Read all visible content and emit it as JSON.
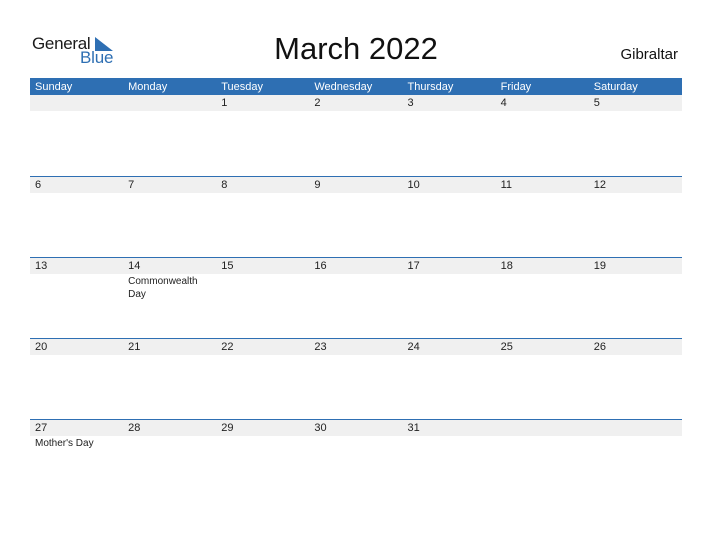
{
  "logo": {
    "word1": "General",
    "word2": "Blue"
  },
  "title": "March 2022",
  "country": "Gibraltar",
  "colors": {
    "accent": "#2e6fb3",
    "band": "#f0f0f0"
  },
  "weekdays": [
    "Sunday",
    "Monday",
    "Tuesday",
    "Wednesday",
    "Thursday",
    "Friday",
    "Saturday"
  ],
  "weeks": [
    {
      "days": [
        {
          "num": "",
          "event": ""
        },
        {
          "num": "",
          "event": ""
        },
        {
          "num": "1",
          "event": ""
        },
        {
          "num": "2",
          "event": ""
        },
        {
          "num": "3",
          "event": ""
        },
        {
          "num": "4",
          "event": ""
        },
        {
          "num": "5",
          "event": ""
        }
      ]
    },
    {
      "days": [
        {
          "num": "6",
          "event": ""
        },
        {
          "num": "7",
          "event": ""
        },
        {
          "num": "8",
          "event": ""
        },
        {
          "num": "9",
          "event": ""
        },
        {
          "num": "10",
          "event": ""
        },
        {
          "num": "11",
          "event": ""
        },
        {
          "num": "12",
          "event": ""
        }
      ]
    },
    {
      "days": [
        {
          "num": "13",
          "event": ""
        },
        {
          "num": "14",
          "event": "Commonwealth Day"
        },
        {
          "num": "15",
          "event": ""
        },
        {
          "num": "16",
          "event": ""
        },
        {
          "num": "17",
          "event": ""
        },
        {
          "num": "18",
          "event": ""
        },
        {
          "num": "19",
          "event": ""
        }
      ]
    },
    {
      "days": [
        {
          "num": "20",
          "event": ""
        },
        {
          "num": "21",
          "event": ""
        },
        {
          "num": "22",
          "event": ""
        },
        {
          "num": "23",
          "event": ""
        },
        {
          "num": "24",
          "event": ""
        },
        {
          "num": "25",
          "event": ""
        },
        {
          "num": "26",
          "event": ""
        }
      ]
    },
    {
      "days": [
        {
          "num": "27",
          "event": "Mother's Day"
        },
        {
          "num": "28",
          "event": ""
        },
        {
          "num": "29",
          "event": ""
        },
        {
          "num": "30",
          "event": ""
        },
        {
          "num": "31",
          "event": ""
        },
        {
          "num": "",
          "event": ""
        },
        {
          "num": "",
          "event": ""
        }
      ]
    }
  ]
}
